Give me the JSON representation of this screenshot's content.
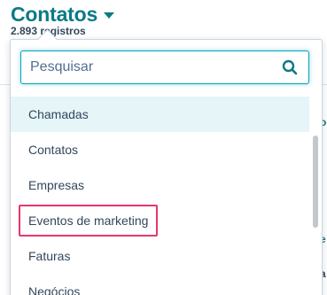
{
  "header": {
    "title": "Contatos",
    "record_count": "2.893 registros"
  },
  "search": {
    "placeholder": "Pesquisar",
    "value": ""
  },
  "options": [
    {
      "label": "Chamadas",
      "highlighted": true
    },
    {
      "label": "Contatos"
    },
    {
      "label": "Empresas"
    },
    {
      "label": "Eventos de marketing",
      "boxed": true
    },
    {
      "label": "Faturas"
    },
    {
      "label": "Negócios"
    }
  ],
  "background_glyphs": [
    "o",
    "I",
    "I",
    "e",
    "a"
  ],
  "colors": {
    "accent": "#0b7a87",
    "search_border": "#00a4bd",
    "highlight": "#e5f5f8",
    "annotation_box": "#e8366f",
    "text": "#33475b"
  },
  "icons": {
    "title_caret": "caret-down-icon",
    "search": "search-icon"
  }
}
